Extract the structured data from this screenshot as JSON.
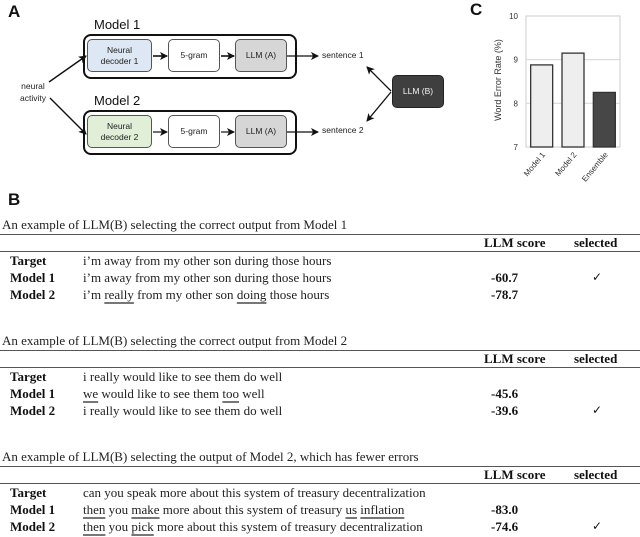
{
  "panelA": {
    "letter": "A",
    "input_label_line1": "neural",
    "input_label_line2": "activity",
    "models": [
      {
        "title": "Model 1",
        "decoder_line1": "Neural",
        "decoder_line2": "decoder 1",
        "decoder_color": "#dde8f4",
        "ngram": "5-gram",
        "llm": "LLM (A)",
        "output": "sentence 1"
      },
      {
        "title": "Model 2",
        "decoder_line1": "Neural",
        "decoder_line2": "decoder 2",
        "decoder_color": "#e1efd8",
        "ngram": "5-gram",
        "llm": "LLM (A)",
        "output": "sentence 2"
      }
    ],
    "selector": "LLM (B)"
  },
  "panelB": {
    "letter": "B",
    "col_score": "LLM score",
    "col_selected": "selected",
    "check_glyph": "✓",
    "examples": [
      {
        "caption": "An example of LLM(B) selecting the correct output from Model 1",
        "rows": [
          {
            "label": "Target",
            "segments": [
              {
                "t": "i’m away from my other son during those hours",
                "err": false
              }
            ],
            "score": "",
            "selected": false
          },
          {
            "label": "Model 1",
            "segments": [
              {
                "t": "i’m away from my other son during those hours",
                "err": false
              }
            ],
            "score": "-60.7",
            "selected": true
          },
          {
            "label": "Model 2",
            "segments": [
              {
                "t": "i’m ",
                "err": false
              },
              {
                "t": "really",
                "err": true
              },
              {
                "t": " from my other son ",
                "err": false
              },
              {
                "t": "doing",
                "err": true
              },
              {
                "t": " those hours",
                "err": false
              }
            ],
            "score": "-78.7",
            "selected": false
          }
        ]
      },
      {
        "caption": "An example of LLM(B) selecting the correct output from Model 2",
        "rows": [
          {
            "label": "Target",
            "segments": [
              {
                "t": "i really would like to see them do well",
                "err": false
              }
            ],
            "score": "",
            "selected": false
          },
          {
            "label": "Model 1",
            "segments": [
              {
                "t": "we",
                "err": true
              },
              {
                "t": " would like to see them ",
                "err": false
              },
              {
                "t": "too",
                "err": true
              },
              {
                "t": " well",
                "err": false
              }
            ],
            "score": "-45.6",
            "selected": false
          },
          {
            "label": "Model 2",
            "segments": [
              {
                "t": "i really would like to see them do well",
                "err": false
              }
            ],
            "score": "-39.6",
            "selected": true
          }
        ]
      },
      {
        "caption": "An example of LLM(B) selecting the output of Model 2, which has fewer errors",
        "rows": [
          {
            "label": "Target",
            "segments": [
              {
                "t": "can you speak more about this system of treasury decentralization",
                "err": false
              }
            ],
            "score": "",
            "selected": false
          },
          {
            "label": "Model 1",
            "segments": [
              {
                "t": "then",
                "err": true
              },
              {
                "t": " you ",
                "err": false
              },
              {
                "t": "make",
                "err": true
              },
              {
                "t": " more about this system of treasury ",
                "err": false
              },
              {
                "t": "us",
                "err": true
              },
              {
                "t": " ",
                "err": false
              },
              {
                "t": "inflation",
                "err": true
              }
            ],
            "score": "-83.0",
            "selected": false
          },
          {
            "label": "Model 2",
            "segments": [
              {
                "t": "then",
                "err": true
              },
              {
                "t": " you ",
                "err": false
              },
              {
                "t": "pick",
                "err": true
              },
              {
                "t": " more about this system of treasury decentralization",
                "err": false
              }
            ],
            "score": "-74.6",
            "selected": true
          }
        ]
      }
    ]
  },
  "panelC": {
    "letter": "C"
  },
  "chart_data": {
    "type": "bar",
    "title": "",
    "xlabel": "",
    "ylabel": "Word Error Rate (%)",
    "categories": [
      "Model 1",
      "Model 2",
      "Ensemble"
    ],
    "values": [
      8.88,
      9.15,
      8.25
    ],
    "colors": [
      "#eeeeee",
      "#eeeeee",
      "#474747"
    ],
    "ylim": [
      7,
      10
    ],
    "yticks": [
      "7",
      "8",
      "9",
      "10"
    ],
    "grid": true,
    "legend": "none"
  }
}
